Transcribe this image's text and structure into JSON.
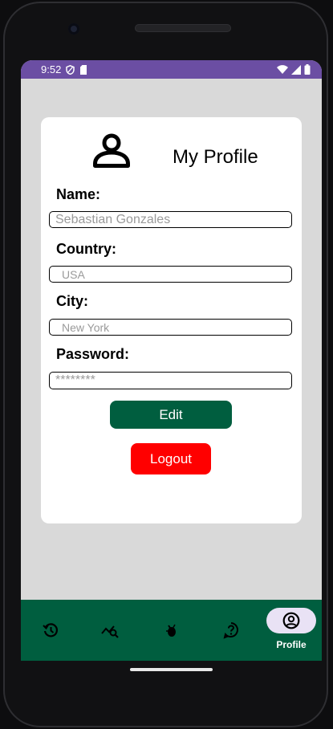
{
  "status_bar": {
    "time": "9:52"
  },
  "profile": {
    "title": "My Profile",
    "fields": [
      {
        "label": "Name:",
        "placeholder": "Sebastian Gonzales"
      },
      {
        "label": "Country:",
        "placeholder": "USA"
      },
      {
        "label": "City:",
        "placeholder": "New York"
      },
      {
        "label": "Password:",
        "placeholder": "********"
      }
    ],
    "edit_label": "Edit",
    "logout_label": "Logout"
  },
  "bottom_nav": {
    "items": [
      {
        "icon": "history-icon"
      },
      {
        "icon": "trend-search-icon"
      },
      {
        "icon": "bug-icon"
      },
      {
        "icon": "help-icon"
      },
      {
        "icon": "account-circle-icon",
        "label": "Profile",
        "selected": true
      }
    ]
  },
  "colors": {
    "status_bar": "#6b4ea3",
    "nav_bar": "#005e3f",
    "edit_button": "#005e3f",
    "logout_button": "#ff0000",
    "selected_pill": "#e9e2f5",
    "screen_background": "#d9d9d9"
  }
}
